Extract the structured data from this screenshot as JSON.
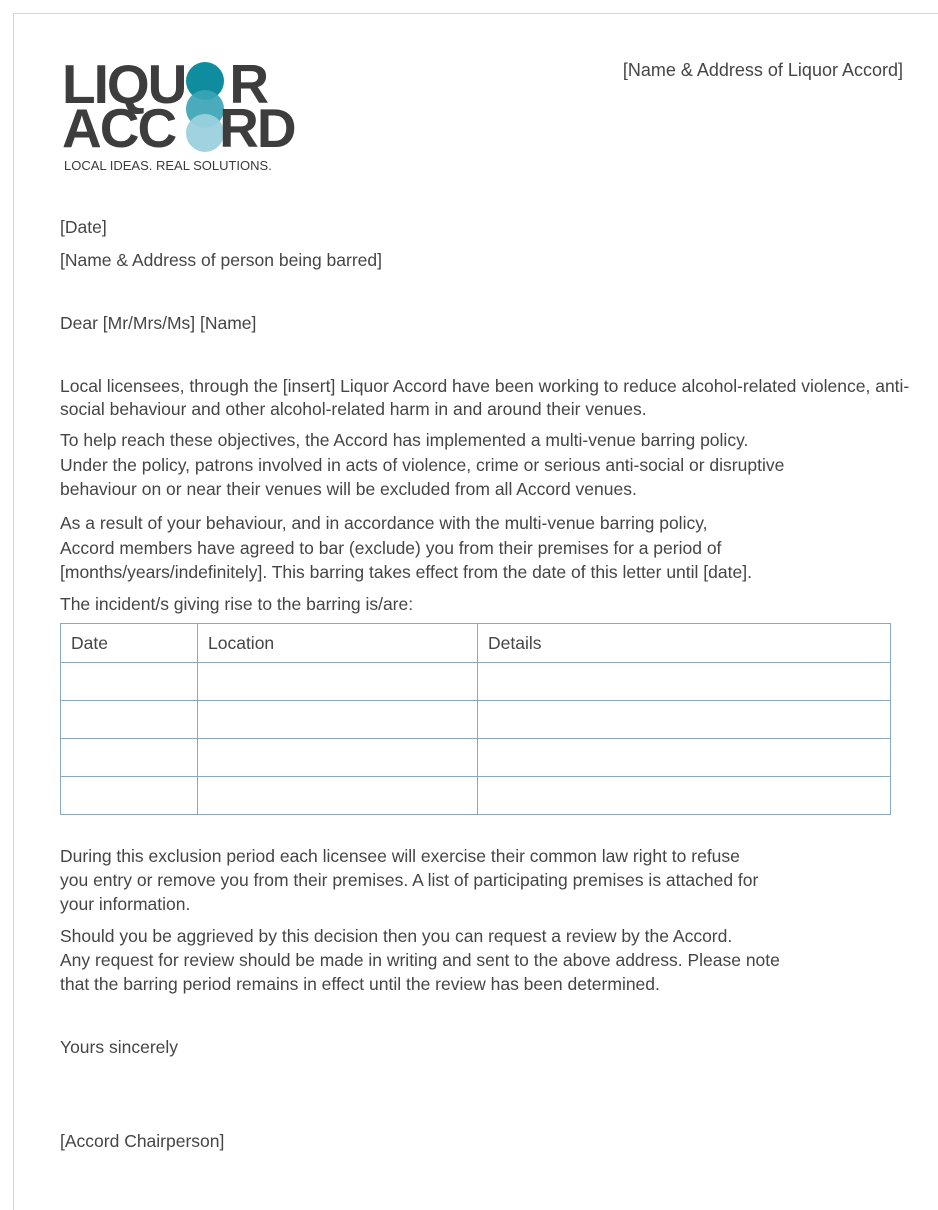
{
  "logo": {
    "line1_left": "LIQU",
    "line1_right": "R",
    "line2_left": "ACC",
    "line2_right": "RD",
    "tagline": "LOCAL IDEAS. REAL SOLUTIONS.",
    "circle_colors": [
      "#0f8c9d",
      "#3aa4b6",
      "#9bd1dd"
    ]
  },
  "header": {
    "accord_address": "[Name & Address of Liquor Accord]"
  },
  "letter": {
    "date": "[Date]",
    "recipient": "[Name & Address of person being barred]",
    "salutation": "Dear [Mr/Mrs/Ms] [Name]",
    "para1": "Local licensees, through the [insert] Liquor Accord have been working to reduce alcohol-related violence, anti-social behaviour and other alcohol-related harm in and around their venues.",
    "para2_lines": [
      "To help reach these objectives, the Accord has implemented a multi-venue barring policy.",
      "Under the policy, patrons involved in acts of violence, crime or serious anti-social or disruptive",
      "behaviour on or near their venues will be excluded from all Accord venues."
    ],
    "para3_lines": [
      "As a result of your behaviour, and in accordance with the multi-venue barring policy,",
      "Accord members have agreed to bar (exclude) you from their premises for a period of",
      "[months/years/indefinitely]. This barring takes effect from the date of this letter until [date]."
    ],
    "incident_intro": "The incident/s giving rise to the barring is/are:",
    "table": {
      "headers": [
        "Date",
        "Location",
        "Details"
      ],
      "rows": [
        [
          "",
          "",
          ""
        ],
        [
          "",
          "",
          ""
        ],
        [
          "",
          "",
          ""
        ],
        [
          "",
          "",
          ""
        ]
      ]
    },
    "para4_lines": [
      "During this exclusion period each licensee will exercise their common law right to refuse",
      "you entry or remove you from their premises. A list of participating premises is attached for",
      "your information."
    ],
    "para5_lines": [
      "Should you be aggrieved by this decision then you can request a review by the Accord.",
      "Any request for review should be made in writing and sent to the above address. Please note",
      "that the barring period remains in effect until the review has been determined."
    ],
    "closing": "Yours sincerely",
    "signatory": "[Accord Chairperson]"
  }
}
